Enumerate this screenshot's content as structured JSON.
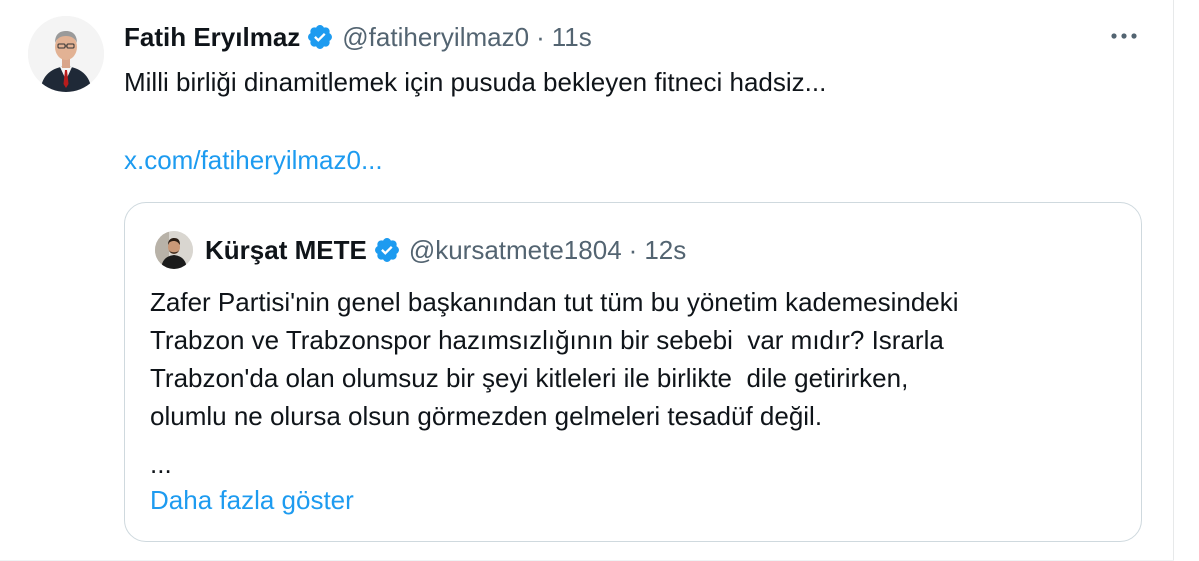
{
  "tweet": {
    "author": {
      "display_name": "Fatih Eryılmaz",
      "handle": "@fatiheryilmaz0",
      "verified": true,
      "avatar": "user-avatar-photo"
    },
    "separator": "·",
    "time": "11s",
    "text": "Milli birliği dinamitlemek için pusuda bekleyen fitneci hadsiz...",
    "link": "x.com/fatiheryilmaz0...",
    "more_icon": "more-horizontal-icon"
  },
  "quote": {
    "author": {
      "display_name": "Kürşat METE",
      "handle": "@kursatmete1804",
      "verified": true,
      "avatar": "user-avatar-photo"
    },
    "separator": "·",
    "time": "12s",
    "lines": [
      "Zafer Partisi'nin genel başkanından tut tüm bu yönetim kademesindeki",
      "Trabzon ve Trabzonspor hazımsızlığının bir sebebi  var mıdır? Israrla",
      "Trabzon'da olan olumsuz bir şeyi kitleleri ile birlikte  dile getirirken,",
      "olumlu ne olursa olsun görmezden gelmeleri tesadüf değil."
    ],
    "ellipsis": "...",
    "show_more": "Daha fazla göster"
  },
  "colors": {
    "text_primary": "#0f1419",
    "text_secondary": "#536471",
    "accent": "#1d9bf0",
    "border": "#cfd9de"
  }
}
